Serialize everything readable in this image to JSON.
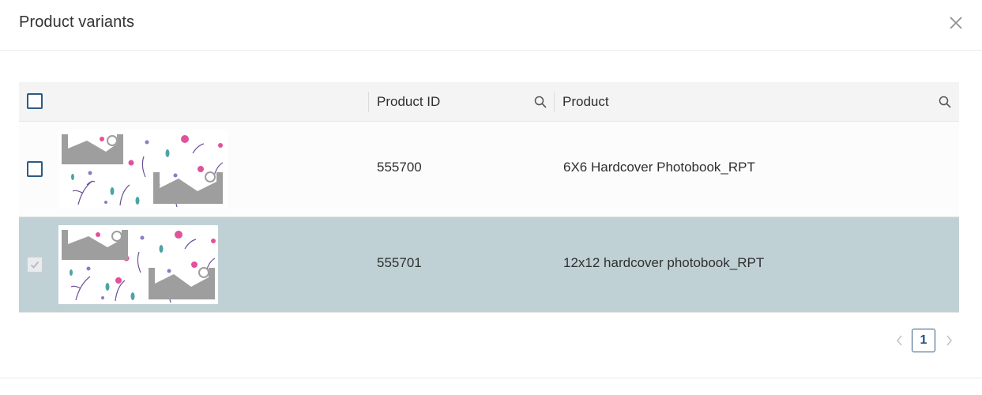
{
  "dialog": {
    "title": "Product variants",
    "close_icon": "close-icon"
  },
  "table": {
    "columns": [
      {
        "key": "select",
        "label": ""
      },
      {
        "key": "product_id",
        "label": "Product ID",
        "icon": "search-icon"
      },
      {
        "key": "product",
        "label": "Product",
        "icon": "search-icon"
      }
    ],
    "rows": [
      {
        "product_id": "555700",
        "product": "6X6 Hardcover Photobook_RPT",
        "checked": false,
        "disabled": false,
        "selected": false,
        "thumbnail": "floral-pattern-photobook-thumbnail"
      },
      {
        "product_id": "555701",
        "product": "12x12 hardcover photobook_RPT",
        "checked": true,
        "disabled": true,
        "selected": true,
        "thumbnail": "floral-pattern-photobook-thumbnail"
      }
    ]
  },
  "pagination": {
    "current_page": "1",
    "prev_icon": "chevron-left-icon",
    "next_icon": "chevron-right-icon"
  },
  "colors": {
    "accent": "#2d5b82",
    "selected_row": "#c0d1d5",
    "header_bg": "#f4f4f4"
  }
}
